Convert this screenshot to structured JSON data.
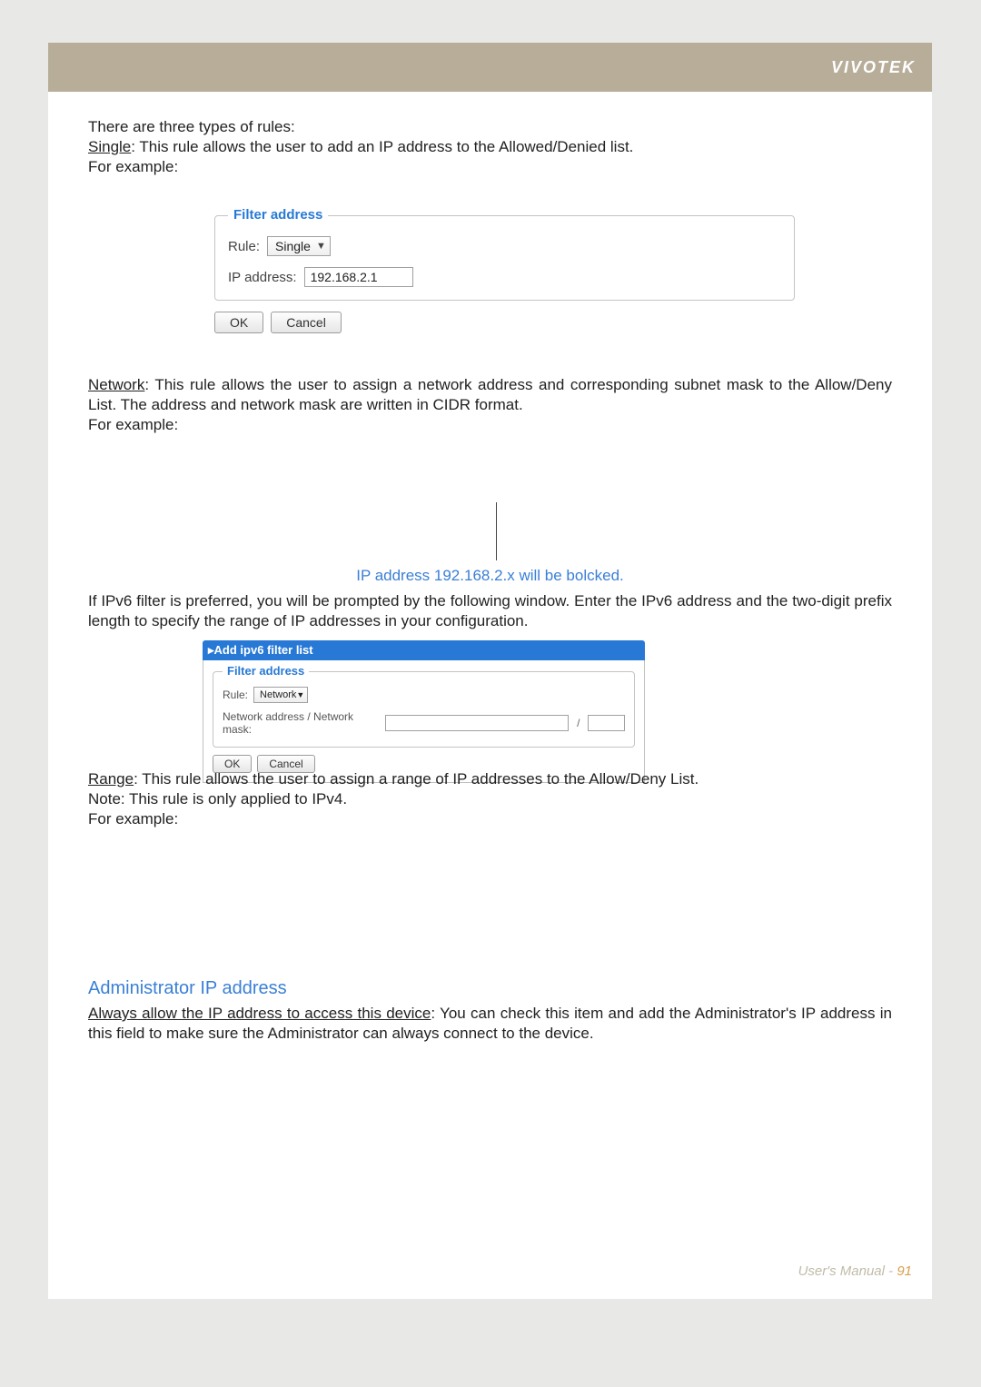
{
  "brand": "VIVOTEK",
  "intro": {
    "line1": "There are three types of rules:",
    "single_label": "Single",
    "single_rest": ": This rule allows the user to add an IP address to the Allowed/Denied list.",
    "example": "For example:"
  },
  "single_panel": {
    "legend": "Filter address",
    "rule_label": "Rule:",
    "rule_value": "Single",
    "ip_label": "IP address:",
    "ip_value": "192.168.2.1",
    "ok": "OK",
    "cancel": "Cancel"
  },
  "network": {
    "label": "Network",
    "rest": ": This rule allows the user to assign a network address and corresponding subnet mask to the Allow/Deny List. The address and network mask are written in CIDR format.",
    "example": "For example:"
  },
  "fig_note": "IP address 192.168.2.x will be bolcked.",
  "ipv6_para": "If IPv6 filter is preferred, you will be prompted by the following window. Enter the IPv6 address and the two-digit prefix length to specify the range of IP addresses in your configuration.",
  "ipv6_panel": {
    "head": "▸Add ipv6 filter list",
    "legend": "Filter address",
    "rule_label": "Rule:",
    "rule_value": "Network",
    "mask_label": "Network address / Network mask:",
    "slash": "/",
    "ok": "OK",
    "cancel": "Cancel"
  },
  "range": {
    "label": "Range",
    "rest": ": This rule allows the user to assign a range of IP addresses to the Allow/Deny List.",
    "note": "Note: This rule is only applied to IPv4.",
    "example": "For example:"
  },
  "admin": {
    "heading": "Administrator IP address",
    "label": "Always allow the IP address to access this device",
    "rest": ": You can check this item and add the Administrator's IP address in this field to make sure the Administrator can always connect to the device."
  },
  "footer": {
    "text": "User's Manual - ",
    "page": "91"
  }
}
